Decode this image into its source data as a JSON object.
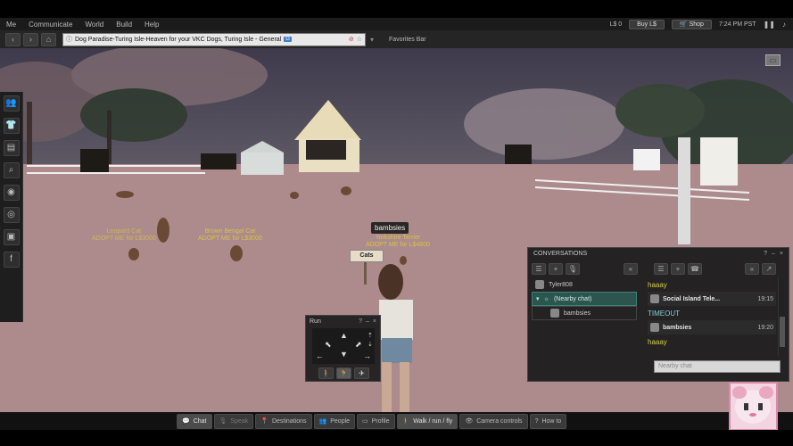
{
  "menu": {
    "items": [
      "Me",
      "Communicate",
      "World",
      "Build",
      "Help"
    ],
    "balance": "L$ 0",
    "buy_label": "Buy L$",
    "shop_label": "Shop",
    "time": "7:24 PM PST"
  },
  "nav": {
    "location": "Dog Paradise-Turing Isle-Heaven for your VKC Dogs, Turing Isle - General",
    "maturity_badge": "G",
    "favorites_label": "Favorites Bar"
  },
  "scene": {
    "sign_cats": "Cats",
    "name_tag": "bambsies",
    "label_brown_bengal_line1": "Brown Bengal Cat",
    "label_brown_bengal_line2": "ADOPT ME for L$3000",
    "label_yorkshire_line1": "Yorkshire Terrier",
    "label_yorkshire_line2": "ADOPT ME for L$4800",
    "label_left_line1": "Leopard Cat",
    "label_left_line2": "ADOPT ME for L$3000"
  },
  "run_window": {
    "title": "Run",
    "help": "?",
    "minimize": "–",
    "close": "×"
  },
  "conversations": {
    "title": "CONVERSATIONS",
    "contacts": [
      {
        "name": "Tyler808"
      },
      {
        "name": "(Nearby chat)"
      },
      {
        "name": "bambsies"
      }
    ],
    "messages": [
      {
        "text": "haaay"
      },
      {
        "sender": "Social Island Tele...",
        "time": "19:15"
      },
      {
        "text": "TIMEOUT"
      },
      {
        "sender": "bambsies",
        "time": "19:20"
      },
      {
        "text": "haaay"
      }
    ],
    "input_placeholder": "Nearby chat"
  },
  "bottom_toolbar": [
    {
      "label": "Chat",
      "icon": "speech-bubble-icon"
    },
    {
      "label": "Speak",
      "icon": "microphone-icon"
    },
    {
      "label": "Destinations",
      "icon": "pin-icon"
    },
    {
      "label": "People",
      "icon": "people-icon"
    },
    {
      "label": "Profile",
      "icon": "profile-card-icon"
    },
    {
      "label": "Walk / run / fly",
      "icon": "walk-icon"
    },
    {
      "label": "Camera controls",
      "icon": "eye-icon"
    },
    {
      "label": "How to",
      "icon": "question-icon"
    }
  ],
  "colors": {
    "chat_yellow": "#d8d04a",
    "chat_cyan": "#7fd1d8",
    "selected_row": "#2c5550"
  }
}
